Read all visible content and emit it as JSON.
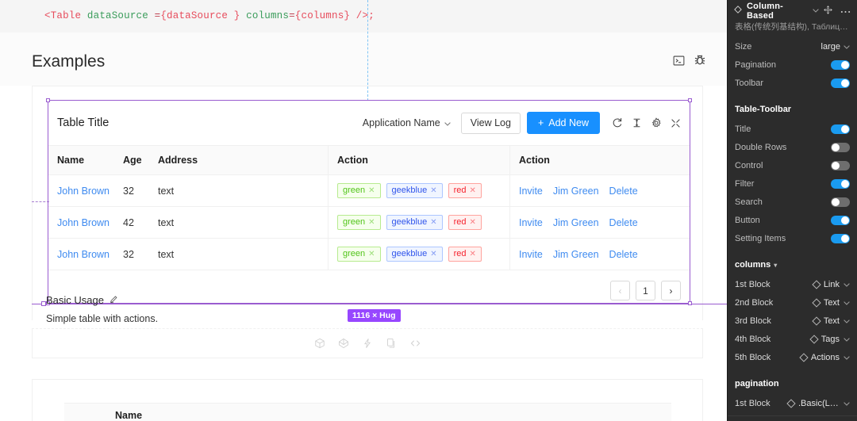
{
  "code": {
    "parts": [
      {
        "t": "<Table",
        "c": "red"
      },
      {
        "t": " dataSource ",
        "c": "green"
      },
      {
        "t": "=",
        "c": "punc"
      },
      {
        "t": "{dataSource }",
        "c": "red"
      },
      {
        "t": " columns",
        "c": "green"
      },
      {
        "t": "=",
        "c": "punc"
      },
      {
        "t": "{columns}",
        "c": "red"
      },
      {
        "t": " />;",
        "c": "red"
      }
    ],
    "full": "<Table dataSource ={dataSource } columns={columns} />;"
  },
  "examples": {
    "title": "Examples",
    "icons": [
      "console-icon",
      "bug-icon"
    ]
  },
  "table": {
    "title": "Table Title",
    "select_label": "Application Name",
    "view_log_label": "View Log",
    "add_new_label": "Add New",
    "tool_icons": [
      "reload-icon",
      "column-height-icon",
      "settings-gear-icon",
      "fullscreen-icon"
    ],
    "columns": [
      "Name",
      "Age",
      "Address",
      "Action",
      "Action"
    ],
    "rows": [
      {
        "name": "John Brown",
        "age": "32",
        "address": "text",
        "tags": [
          {
            "label": "green",
            "style": "green"
          },
          {
            "label": "geekblue",
            "style": "geekblue"
          },
          {
            "label": "red",
            "style": "red"
          }
        ],
        "actions": [
          "Invite",
          "Jim Green",
          "Delete"
        ]
      },
      {
        "name": "John Brown",
        "age": "42",
        "address": "text",
        "tags": [
          {
            "label": "green",
            "style": "green"
          },
          {
            "label": "geekblue",
            "style": "geekblue"
          },
          {
            "label": "red",
            "style": "red"
          }
        ],
        "actions": [
          "Invite",
          "Jim Green",
          "Delete"
        ]
      },
      {
        "name": "John Brown",
        "age": "32",
        "address": "text",
        "tags": [
          {
            "label": "green",
            "style": "green"
          },
          {
            "label": "geekblue",
            "style": "geekblue"
          },
          {
            "label": "red",
            "style": "red"
          }
        ],
        "actions": [
          "Invite",
          "Jim Green",
          "Delete"
        ]
      }
    ],
    "pagination": {
      "prev": "‹",
      "page": "1",
      "next": "›"
    }
  },
  "basic_usage": {
    "label": "Basic Usage",
    "edit_icon": "pencil-icon",
    "description": "Simple table with actions.",
    "size_badge": "1116 × Hug",
    "footer_icons": [
      "codesandbox-icon",
      "codepen-icon",
      "bolt-icon",
      "copy-icon",
      "code-brackets-icon"
    ]
  },
  "second_card": {
    "column_label": "Name"
  },
  "panel": {
    "header": {
      "icon": "diamond-component-icon",
      "title": "Column-Based",
      "chevron": "∨",
      "reset_icon": "reset-instance-icon",
      "more_icon": "more-options-icon"
    },
    "subtitle": "表格(传统列基结构), Таблица Table - ...",
    "props": [
      {
        "label": "Size",
        "type": "select",
        "value": "large"
      },
      {
        "label": "Pagination",
        "type": "toggle",
        "value": "on"
      },
      {
        "label": "Toolbar",
        "type": "toggle",
        "value": "on"
      }
    ],
    "toolbar_section": {
      "title": "Table-Toolbar",
      "items": [
        {
          "label": "Title",
          "value": "on"
        },
        {
          "label": "Double Rows",
          "value": "off"
        },
        {
          "label": "Control",
          "value": "off"
        },
        {
          "label": "Filter",
          "value": "on"
        },
        {
          "label": "Search",
          "value": "off"
        },
        {
          "label": "Button",
          "value": "on"
        },
        {
          "label": "Setting Items",
          "value": "on"
        }
      ]
    },
    "columns_section": {
      "title": "columns",
      "chevron": "▾",
      "items": [
        {
          "label": "1st Block",
          "value": "Link"
        },
        {
          "label": "2nd Block",
          "value": "Text"
        },
        {
          "label": "3rd Block",
          "value": "Text"
        },
        {
          "label": "4th Block",
          "value": "Tags"
        },
        {
          "label": "5th Block",
          "value": "Actions"
        }
      ]
    },
    "pagination_section": {
      "title": "pagination",
      "items": [
        {
          "label": "1st Block",
          "value": ".Basic(Le..."
        }
      ]
    }
  },
  "colors": {
    "primary": "#1890ff",
    "link": "#3f8bf0",
    "selection": "#9a5cd0",
    "badge": "#9747ff",
    "panel_bg": "#2c2c2c",
    "toggle_on": "#1a9bf0"
  }
}
